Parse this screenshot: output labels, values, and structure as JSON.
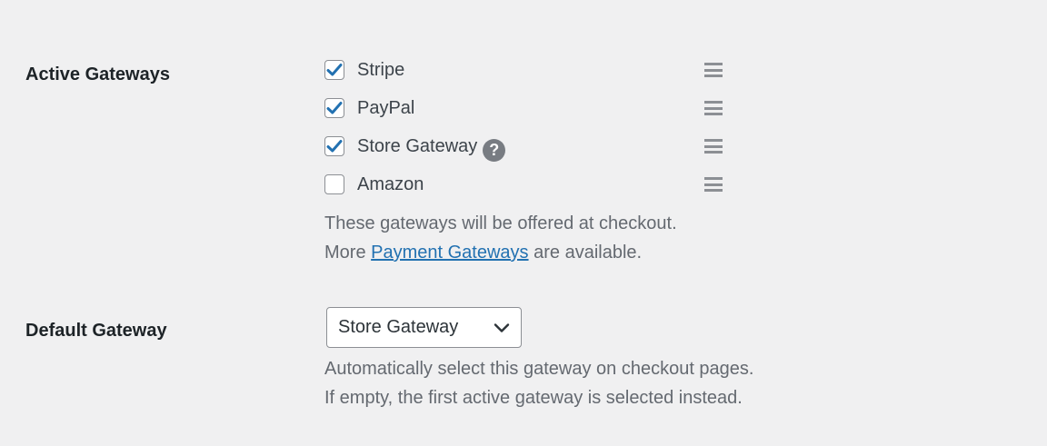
{
  "active_gateways": {
    "label": "Active Gateways",
    "items": [
      {
        "label": "Stripe",
        "checked": true,
        "help": false
      },
      {
        "label": "PayPal",
        "checked": true,
        "help": false
      },
      {
        "label": "Store Gateway",
        "checked": true,
        "help": true
      },
      {
        "label": "Amazon",
        "checked": false,
        "help": false
      }
    ],
    "help_glyph": "?",
    "description_line1": "These gateways will be offered at checkout.",
    "description_line2_prefix": "More",
    "description_link": "Payment Gateways",
    "description_line2_suffix": "are available."
  },
  "default_gateway": {
    "label": "Default Gateway",
    "selected": "Store Gateway",
    "description_line1": "Automatically select this gateway on checkout pages.",
    "description_line2": "If empty, the first active gateway is selected instead."
  },
  "colors": {
    "background": "#f0f0f1",
    "checkmark": "#2271b1",
    "link": "#2271b1",
    "help_icon": "#787c82"
  },
  "icons": {
    "checkbox_check": "checkmark-icon",
    "help": "question-mark-icon",
    "reorder": "drag-handle-icon",
    "select_arrow": "chevron-down-icon"
  }
}
